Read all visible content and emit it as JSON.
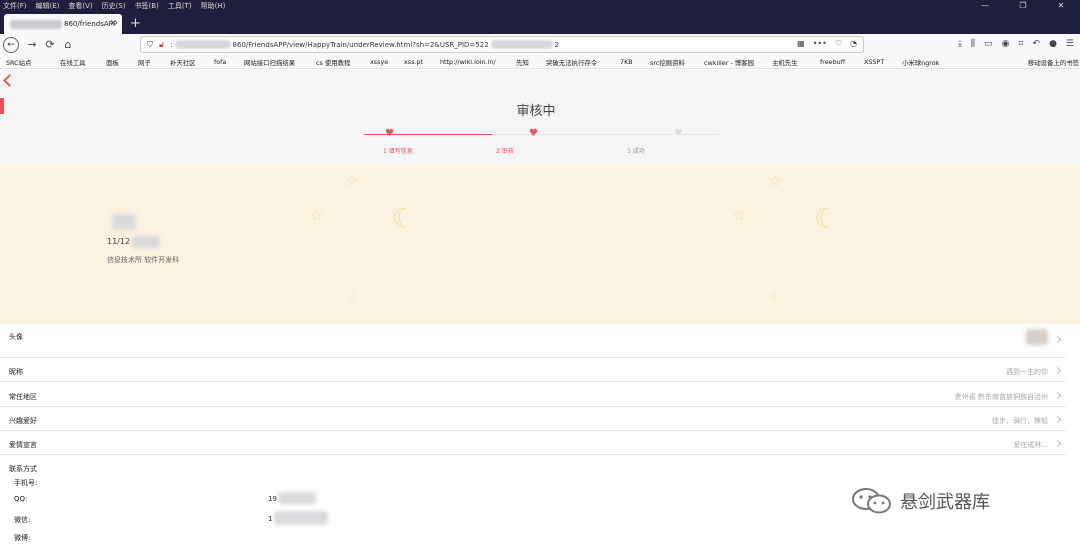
{
  "os_menu": [
    "文件(F)",
    "编辑(E)",
    "查看(V)",
    "历史(S)",
    "书签(B)",
    "工具(T)",
    "帮助(H)"
  ],
  "window_controls": [
    "—",
    "❐",
    "✕"
  ],
  "tab": {
    "title": "860/friendsAPP",
    "new_tab": "+"
  },
  "address": {
    "url_prefix": ":",
    "url_middle": "860/FriendsAPP/view/HappyTrain/underReview.html?sh=2&USR_PID=522",
    "url_suffix": "2"
  },
  "bookmarks": [
    "SRC站点",
    "在线工具",
    "面板",
    "网子",
    "补天社区",
    "fofa",
    "网站接口扫描结果",
    "cs 使用教程",
    "xssye",
    "xss.pt",
    "http://wiki.ioin.in/",
    "先知",
    "突破无法执行存令",
    "7KB",
    "src挖掘资料",
    "cwkiller - 博客园",
    "主机先生",
    "freebuff",
    "XSSPT",
    "小米球ngrok"
  ],
  "bookmarks_more": "移动设备上的书签",
  "page": {
    "title": "审核中",
    "steps": [
      "1 填写信息",
      "2 审核",
      "3 成功"
    ],
    "colors": {
      "accent": "#e9535a",
      "banner_bg": "#fbf2e0",
      "header_bg": "#f5f5f5"
    }
  },
  "banner": {
    "date": "11/12",
    "department": "信息技术所  软件开发科"
  },
  "profile": [
    {
      "label": "头像",
      "value": ""
    },
    {
      "label": "昵称",
      "value": "遇到一生的你"
    },
    {
      "label": "常住地区",
      "value": "贵州省 黔东南苗族侗族自治州"
    },
    {
      "label": "兴趣爱好",
      "value": "徒步，骑行，撑船"
    },
    {
      "label": "爱情宣言",
      "value": "爱在成林..."
    }
  ],
  "contact": {
    "title": "联系方式",
    "phone_label": "手机号:",
    "qq_label": "QQ:",
    "qq_value": "19",
    "wechat_label": "微信:",
    "wechat_value": "1",
    "weibo_label": "微博:"
  },
  "watermark": "悬剑武器库"
}
